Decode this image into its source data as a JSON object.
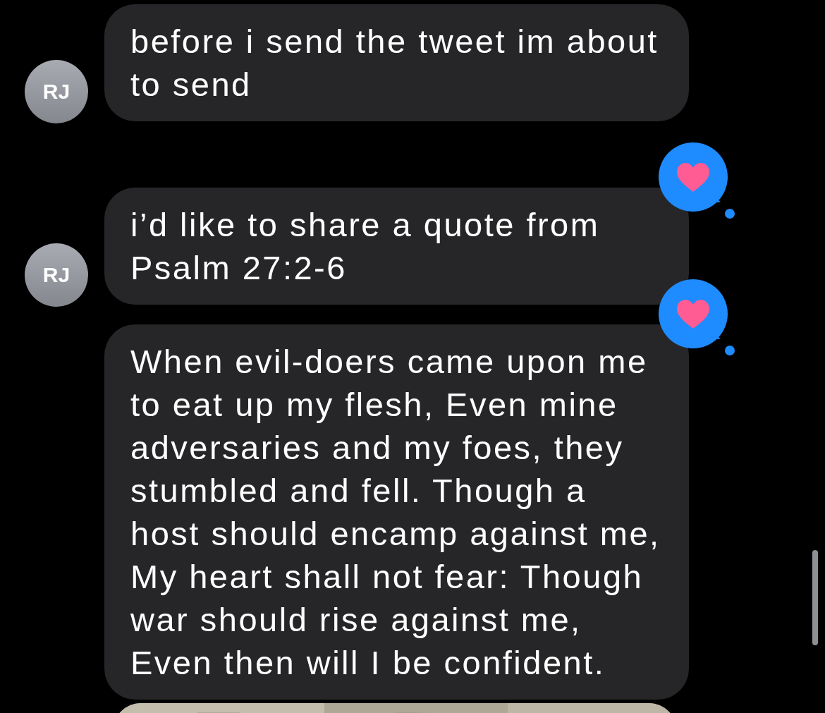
{
  "messages": [
    {
      "avatar": "RJ",
      "text": "before i send the tweet im about to send"
    },
    {
      "avatar": "RJ",
      "text": "i’d like to share a quote from Psalm 27:2-6",
      "reaction": {
        "kind": "heart"
      }
    },
    {
      "text": "When evil-doers came upon me to eat up my flesh, Even mine adversaries and my foes, they stumbled and fell. Though a host should encamp against me, My heart shall not fear: Though war should rise against me, Even then will I be confident.",
      "reaction": {
        "kind": "heart"
      }
    }
  ]
}
